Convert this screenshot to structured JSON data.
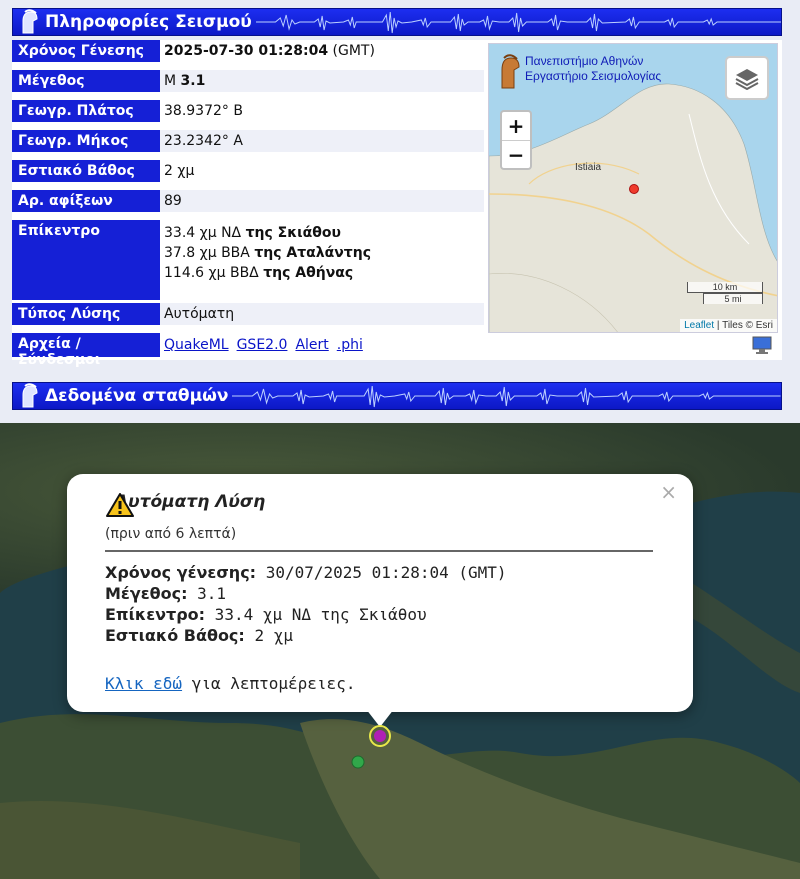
{
  "section1": {
    "title": "Πληροφορίες Σεισμού"
  },
  "section2": {
    "title": "Δεδομένα σταθμών"
  },
  "info": {
    "origin_time_label": "Χρόνος Γένεσης",
    "origin_time_value": "2025-07-30 01:28:04",
    "origin_time_tz": "(GMT)",
    "magnitude_label": "Μέγεθος",
    "magnitude_prefix": "M",
    "magnitude_value": "3.1",
    "lat_label": "Γεωγρ. Πλάτος",
    "lat_value": "38.9372° Β",
    "lon_label": "Γεωγρ. Μήκος",
    "lon_value": "23.2342° Α",
    "depth_label": "Εστιακό Βάθος",
    "depth_value": "2 χμ",
    "arrivals_label": "Αρ. αφίξεων",
    "arrivals_value": "89",
    "epicenter_label": "Επίκεντρο",
    "epicenter": [
      {
        "dist": "33.4 χμ ΝΔ",
        "place": "της Σκιάθου"
      },
      {
        "dist": "37.8 χμ ΒΒΑ",
        "place": "της Αταλάντης"
      },
      {
        "dist": "114.6 χμ ΒΒΔ",
        "place": "της Αθήνας"
      }
    ],
    "solution_label": "Τύπος Λύσης",
    "solution_value": "Αυτόματη",
    "files_label": "Αρχεία / Σύνδεσμοι",
    "files": [
      "QuakeML",
      "GSE2.0",
      "Alert",
      ".phi"
    ]
  },
  "small_map": {
    "logo_line1": "Πανεπιστήμιο Αθηνών",
    "logo_line2": "Εργαστήριο Σεισμολογίας",
    "zoom_in": "+",
    "zoom_out": "−",
    "place": "Istiaia",
    "scale_km": "10 km",
    "scale_mi": "5 mi",
    "attribution_link": "Leaflet",
    "attribution_rest": " | Tiles © Esri"
  },
  "popup": {
    "title": "Αυτόματη Λύση",
    "ago": "(πριν από 6 λεπτά)",
    "close": "×",
    "origin_time_label": "Χρόνος γένεσης:",
    "origin_time_value": " 30/07/2025 01:28:04 (GMT)",
    "magnitude_label": "Μέγεθος:",
    "magnitude_value": " 3.1",
    "epicenter_label": "Επίκεντρο:",
    "epicenter_value": " 33.4 χμ ΝΔ της Σκιάθου",
    "depth_label": "Εστιακό Βάθος:",
    "depth_value": " 2 χμ",
    "more_link": "Κλικ εδώ",
    "more_rest": " για λεπτομέρειες."
  },
  "colors": {
    "bar": "#1520d6",
    "quake": "#ef3b2c",
    "marker": "#b01fb5",
    "station": "#31a84a"
  }
}
